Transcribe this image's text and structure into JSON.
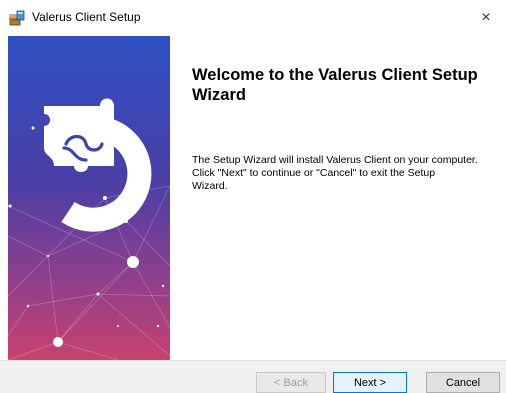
{
  "window": {
    "title": "Valerus Client Setup",
    "close_glyph": "×"
  },
  "welcome": {
    "title": "Welcome to the Valerus Client Setup Wizard",
    "body": "The Setup Wizard will install Valerus Client on your computer.\n Click \"Next\" to continue or \"Cancel\" to exit the Setup\n Wizard."
  },
  "buttons": {
    "back": "< Back",
    "next": "Next >",
    "cancel": "Cancel"
  },
  "icons": {
    "app": "installer-icon",
    "logo": "puzzle-logo-icon",
    "close": "close-icon"
  },
  "colors": {
    "banner_top": "#2e4fc0",
    "banner_mid": "#5b3d9e",
    "banner_bottom": "#c43f6e",
    "default_button_border": "#0078d7"
  }
}
